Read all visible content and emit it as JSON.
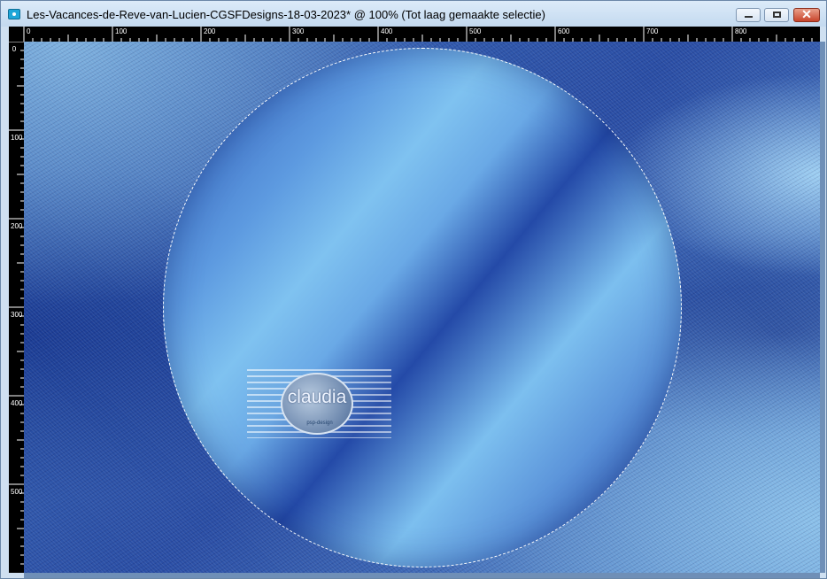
{
  "window": {
    "title": "Les-Vacances-de-Reve-van-Lucien-CGSFDesigns-18-03-2023* @ 100% (Tot laag gemaakte selectie)",
    "controls": {
      "minimize": "",
      "maximize": "",
      "close": "✕"
    }
  },
  "ruler": {
    "horizontal": [
      "0",
      "100",
      "200",
      "300",
      "400",
      "500",
      "600",
      "700",
      "800"
    ],
    "vertical": [
      "0",
      "100",
      "200",
      "300",
      "400",
      "500"
    ]
  },
  "watermark": {
    "text": "claudia",
    "subtext": "psp-design"
  },
  "colors": {
    "titlebar": "#cfe0f1",
    "ruler": "#000000",
    "accent_light_blue": "#7fc2f0",
    "accent_dark_blue": "#244aa8"
  }
}
